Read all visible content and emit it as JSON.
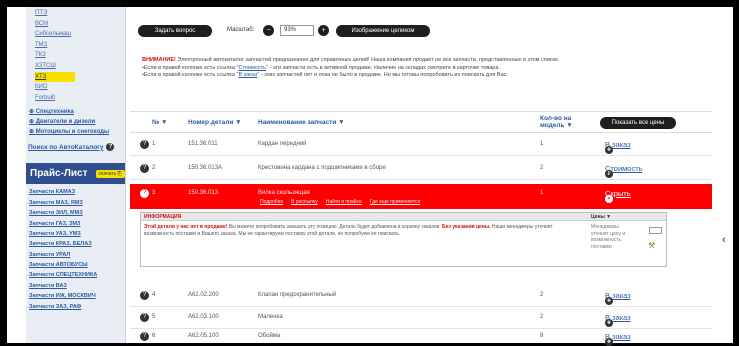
{
  "sidebar": {
    "models": [
      "ПТЭ",
      "ВСМ",
      "Сибсельмаш",
      "ТМ3",
      "ТКЗ",
      "ХЗТСШ",
      "ХТЗ",
      "КИО",
      "Forbuilt"
    ],
    "active_model": "ХТЗ",
    "categories": [
      "Спецтехника",
      "Двигатели и дизели",
      "Мотоциклы и снегоходы"
    ],
    "search_label": "Поиск по АвтоКаталогу",
    "price_title": "Прайс-Лист",
    "download_label": "скачать",
    "price_items": [
      "Запчасти КАМАЗ",
      "Запчасти МАЗ, ЯМЗ",
      "Запчасти ЗИЛ, ММЗ",
      "Запчасти ГАЗ, ЗМЗ",
      "Запчасти УАЗ, УМЗ",
      "Запчасти КРАЗ, БЕЛАЗ",
      "Запчасти УРАЛ",
      "Запчасти АВТОБУСЫ",
      "Запчасти СПЕЦТЕХНИКА",
      "Запчасти ВАЗ",
      "Запчасти ИЖ, МОСКВИЧ",
      "Запчасти ЗАЗ, РАФ"
    ]
  },
  "toolbar": {
    "ask_label": "Задать вопрос",
    "zoom_label": "Масштаб:",
    "zoom_value": "93%",
    "fullimage_label": "Изображение целиком"
  },
  "notice": {
    "warn": "ВНИМАНИЕ!",
    "line1": " Электронный автокаталог запчастей предназначен для справочных целей! Наша компания продает не все запчасти, представленные в этом списке.",
    "line2a": "•Если в правой колонке есть ссылка \"",
    "line2link": "Стоимость",
    "line2b": "\" - эти запчасти есть в активной продаже. Наличие на складах смотрите в карточке товара.",
    "line3a": "•Если в правой колонке есть ссылка \"",
    "line3link": "В заказ",
    "line3b": "\" - этих запчастей нет и пока не было в продаже. Но мы готовы попробовать их поискать для Вас."
  },
  "table": {
    "col_no": "№ ▼",
    "col_part": "Номер детали ▼",
    "col_name": "Наименование запчасти ▼",
    "col_qty": "Кол-во на модель ▼",
    "show_all": "Показать все цены",
    "rows": [
      {
        "n": "1",
        "part": "151.36.011",
        "name": "Кардан передний",
        "qty": "1",
        "action": "В заказ"
      },
      {
        "n": "2",
        "part": "150.36.013А",
        "name": "Крестовина кардана с подшипниками в сборе",
        "qty": "2",
        "action": "Стоимость"
      },
      {
        "n": "3",
        "part": "150.36.013",
        "name": "Вилка скользящая",
        "qty": "1",
        "action": "Скрыть"
      },
      {
        "n": "4",
        "part": "А62.02.200",
        "name": "Клапан предохранительный",
        "qty": "2",
        "action": "В заказ"
      },
      {
        "n": "5",
        "part": "А62.03.100",
        "name": "Маленка",
        "qty": "2",
        "action": "В заказ"
      },
      {
        "n": "6",
        "part": "А62.05.100",
        "name": "Обойма",
        "qty": "8",
        "action": "В заказ"
      }
    ],
    "sublinks": [
      "Подробно",
      "В рассылку",
      "Найти в прайсе",
      "Где еще применяется"
    ]
  },
  "info": {
    "head": "ИНФОРМАЦИЯ",
    "prices_head": "Цены ▼",
    "body_bold": "Этой детали у нас нет в продаже!",
    "body1": " Вы можете попробовать заказать эту позицию. Деталь будет добавлена в корзину заказов. ",
    "body_bold2": "Без указания цены.",
    "body2": " Наши менеджеры уточнят возможность поставки и Вашего заказа. Мы не гарантируем поставку этой детали, но попробуем ее поискать.",
    "side": "Менеджеры уточнят цену и возможность поставки"
  }
}
